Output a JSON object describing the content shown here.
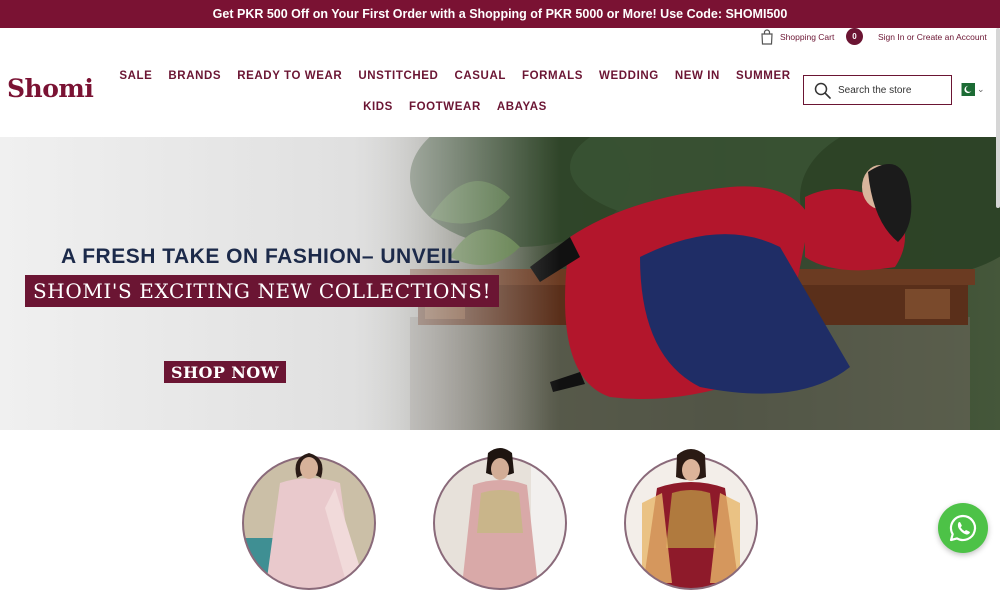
{
  "announcement": "Get PKR 500 Off on Your First Order with a Shopping of PKR 5000 or More! Use Code: SHOMI500",
  "header": {
    "cart_label": "Shopping Cart",
    "cart_count": "0",
    "account_text": "Sign In or Create an Account",
    "logo_text": "Shomi",
    "search_placeholder": "Search the store",
    "country_flag_icon": "pakistan-flag-icon"
  },
  "nav": {
    "row1": [
      "SALE",
      "BRANDS",
      "READY TO WEAR",
      "UNSTITCHED",
      "CASUAL",
      "FORMALS",
      "WEDDING",
      "NEW IN",
      "SUMMER"
    ],
    "row2": [
      "KIDS",
      "FOOTWEAR",
      "ABAYAS"
    ]
  },
  "hero": {
    "headline": "A FRESH TAKE ON FASHION– UNVEIL",
    "subheadline": "SHOMI'S EXCITING NEW COLLECTIONS!",
    "cta": "SHOP NOW"
  },
  "categories": [
    {
      "icon": "category-image-light-pink-outfit"
    },
    {
      "icon": "category-image-pink-embroidered-outfit"
    },
    {
      "icon": "category-image-red-bridal-outfit"
    }
  ],
  "colors": {
    "brand": "#6b1533",
    "announcement_bg": "#7a1233",
    "whatsapp": "#4dc247"
  },
  "floating": {
    "whatsapp_icon": "whatsapp-icon"
  }
}
